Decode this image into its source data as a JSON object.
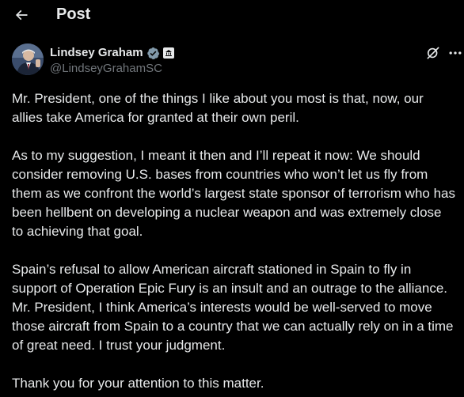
{
  "header": {
    "title": "Post",
    "back_icon": "arrow-left-icon"
  },
  "author": {
    "name": "Lindsey Graham",
    "handle": "@LindseyGrahamSC",
    "verified_badge_color": "#829aab",
    "icons": [
      "verified-badge-icon",
      "government-badge-icon",
      "grok-icon",
      "more-icon"
    ]
  },
  "post": {
    "paragraphs": [
      "Mr. President, one of the things I like about you most is that, now, our allies take America for granted at their own peril.",
      "As to my suggestion, I meant it then and I’ll repeat it now: We should consider removing U.S. bases from countries who won’t let us fly from them as we confront the world’s largest state sponsor of terrorism who has been hellbent on developing a nuclear weapon and was extremely close to achieving that goal.",
      "Spain’s refusal to allow American aircraft stationed in Spain to fly in support of Operation Epic Fury is an insult and an outrage to the alliance. Mr. President, I think America’s interests would be well-served to move those aircraft from Spain to a country that we can actually rely on in a time of great need. I trust your judgment.",
      "Thank you for your attention to this matter."
    ]
  },
  "colors": {
    "background": "#000000",
    "text_primary": "#e7e9ea",
    "text_secondary": "#71767b"
  }
}
